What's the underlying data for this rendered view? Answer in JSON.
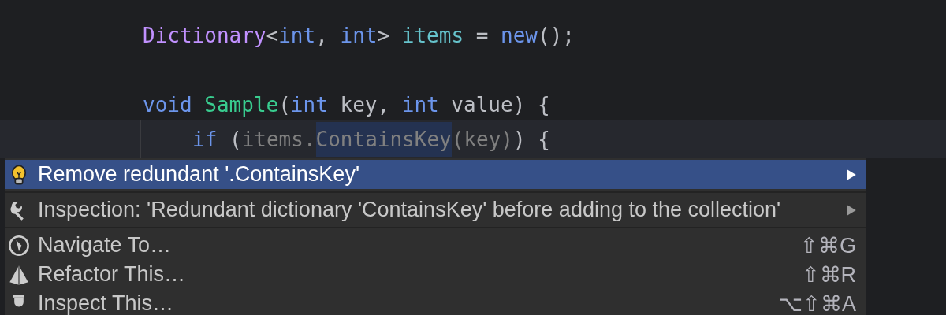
{
  "editor": {
    "blocks": [
      {
        "lines": [
          {
            "tokens": [
              {
                "text": "Dictionary",
                "kind": "type"
              },
              {
                "text": "<",
                "kind": "plain"
              },
              {
                "text": "int",
                "kind": "keyword"
              },
              {
                "text": ", ",
                "kind": "plain"
              },
              {
                "text": "int",
                "kind": "keyword"
              },
              {
                "text": "> ",
                "kind": "plain"
              },
              {
                "text": "items",
                "kind": "field"
              },
              {
                "text": " = ",
                "kind": "plain"
              },
              {
                "text": "new",
                "kind": "keyword"
              },
              {
                "text": "();",
                "kind": "plain"
              }
            ]
          }
        ]
      },
      {
        "lines": [
          {
            "tokens": [
              {
                "text": "void",
                "kind": "keyword"
              },
              {
                "text": " Sample",
                "kind": "method"
              },
              {
                "text": "(",
                "kind": "plain"
              },
              {
                "text": "int",
                "kind": "keyword"
              },
              {
                "text": " key, ",
                "kind": "plain"
              },
              {
                "text": "int",
                "kind": "keyword"
              },
              {
                "text": " value) {",
                "kind": "plain"
              }
            ],
            "children": [
              {
                "current": true,
                "tokens": [
                  {
                    "text": "if",
                    "kind": "keyword"
                  },
                  {
                    "text": " (",
                    "kind": "plain"
                  },
                  {
                    "text": "items.",
                    "kind": "dim"
                  },
                  {
                    "text": "ContainsKey",
                    "kind": "dim",
                    "highlighted": true
                  },
                  {
                    "text": "(key)",
                    "kind": "dim"
                  },
                  {
                    "text": ") {",
                    "kind": "plain"
                  }
                ]
              }
            ]
          }
        ]
      }
    ]
  },
  "menu": {
    "groups": [
      {
        "items": [
          {
            "label": "Remove redundant '.ContainsKey'",
            "submenu": true,
            "selected": true
          }
        ]
      },
      {
        "items": [
          {
            "label": "Inspection: 'Redundant dictionary 'ContainsKey' before adding to the collection'",
            "submenu": true,
            "selected": false
          }
        ]
      },
      {
        "items": [
          {
            "label": "Navigate To…",
            "shortcut": "⇧⌘G",
            "selected": false
          },
          {
            "label": "Refactor This…",
            "shortcut": "⇧⌘R",
            "selected": false
          },
          {
            "label": "Inspect This…",
            "shortcut": "⌥⇧⌘A",
            "selected": false
          }
        ]
      }
    ]
  }
}
